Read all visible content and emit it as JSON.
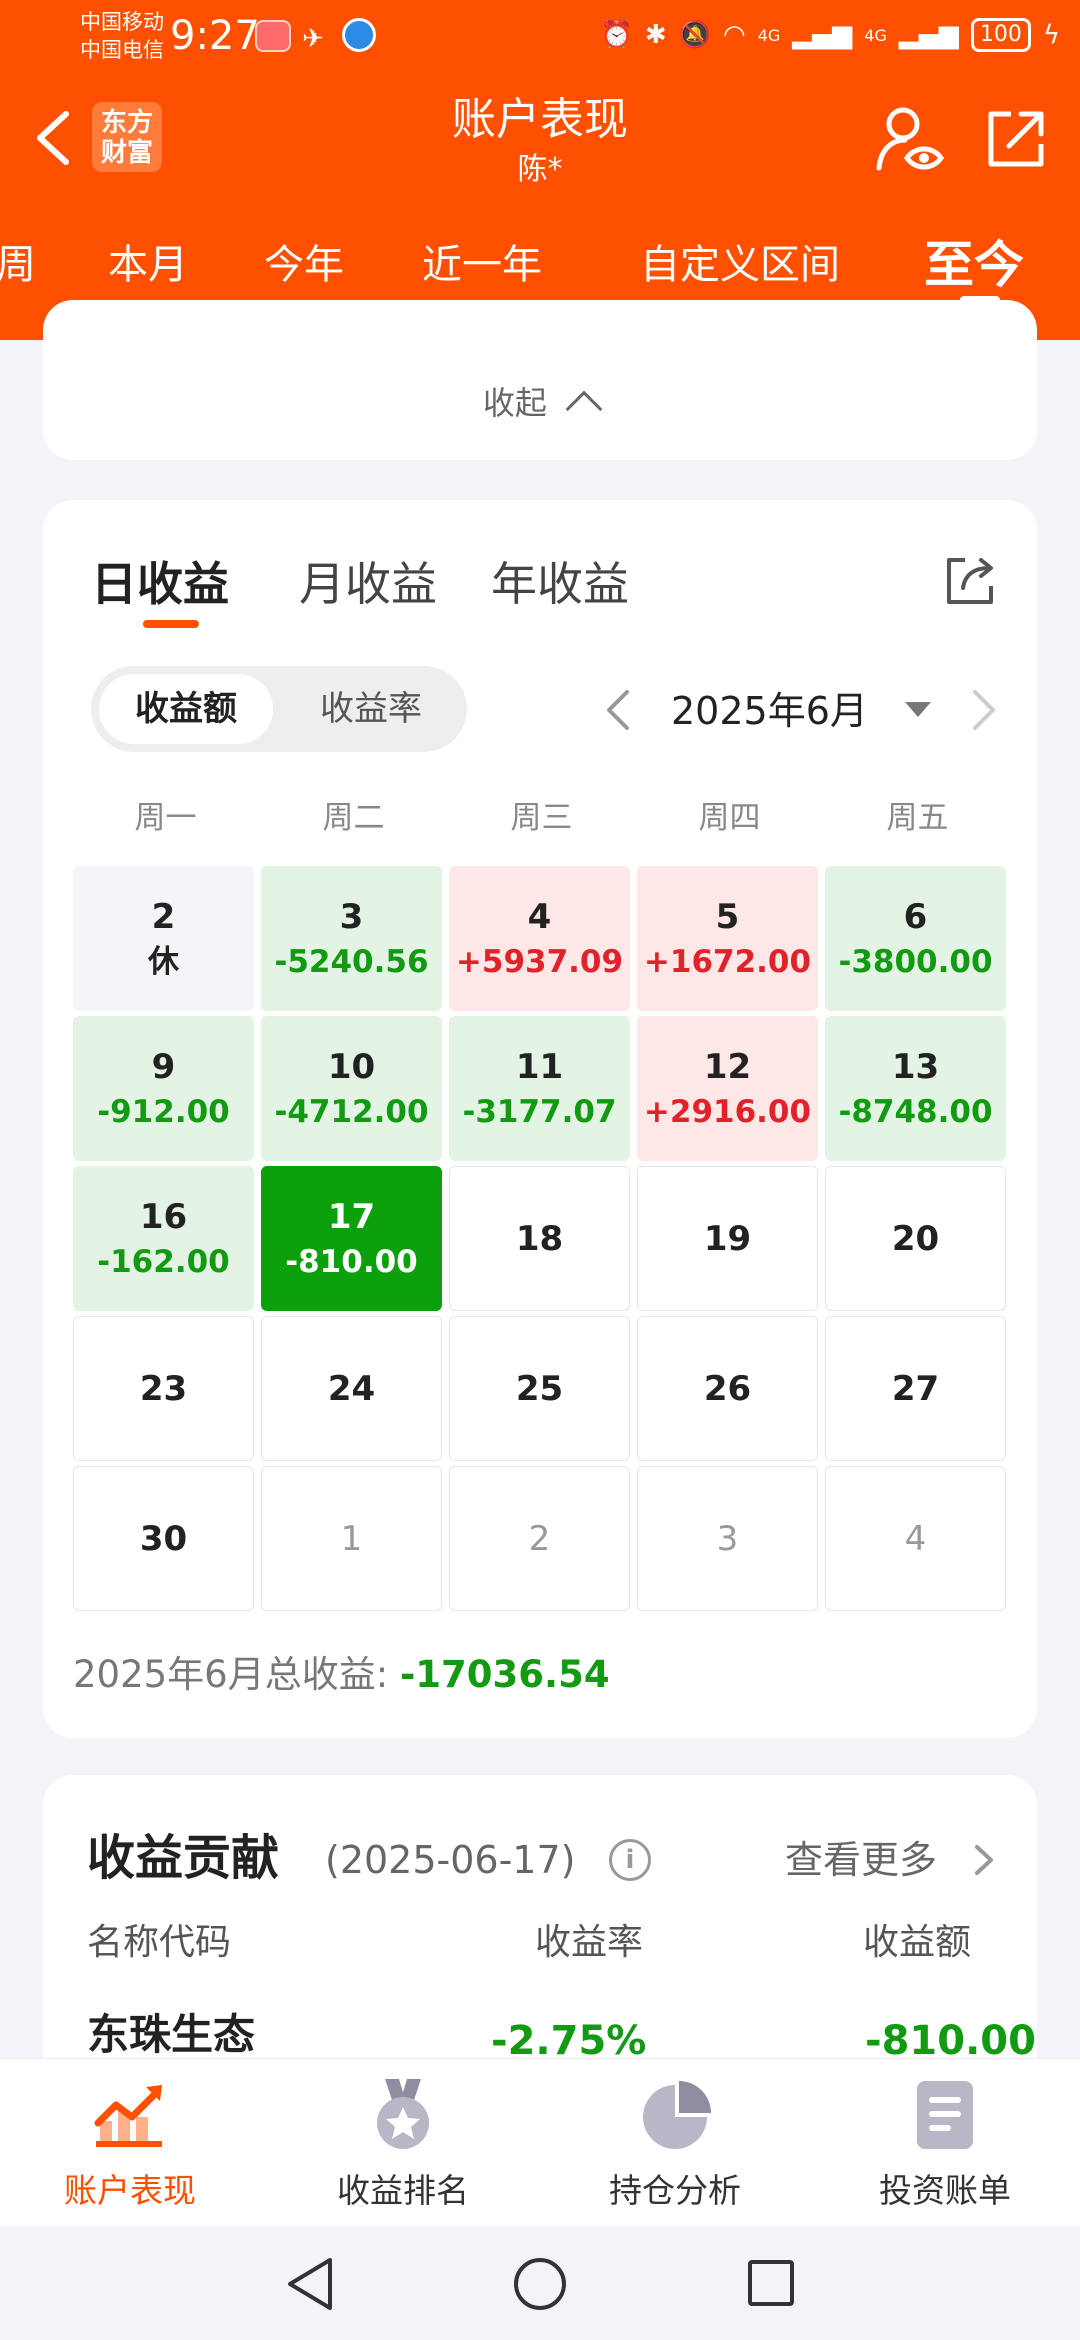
{
  "status_bar": {
    "carrier1": "中国移动",
    "carrier2": "中国电信",
    "time": "9:27",
    "signal1": "4G",
    "signal2": "4G",
    "battery": "100"
  },
  "header": {
    "logo_line1": "东方",
    "logo_line2": "财富",
    "title": "账户表现",
    "subtitle": "陈*",
    "periods": [
      "周",
      "本月",
      "今年",
      "近一年",
      "自定义区间",
      "至今"
    ],
    "active_period": "至今"
  },
  "collapse": {
    "label": "收起"
  },
  "calendar": {
    "tabs": [
      "日收益",
      "月收益",
      "年收益"
    ],
    "active_tab": "日收益",
    "segment": [
      "收益额",
      "收益率"
    ],
    "active_segment": "收益额",
    "month_label": "2025年6月",
    "weekdays": [
      "周一",
      "周二",
      "周三",
      "周四",
      "周五"
    ],
    "days": [
      {
        "day": "2",
        "value": "休",
        "state": "rest"
      },
      {
        "day": "3",
        "value": "-5240.56",
        "state": "loss"
      },
      {
        "day": "4",
        "value": "+5937.09",
        "state": "gain"
      },
      {
        "day": "5",
        "value": "+1672.00",
        "state": "gain"
      },
      {
        "day": "6",
        "value": "-3800.00",
        "state": "loss"
      },
      {
        "day": "9",
        "value": "-912.00",
        "state": "loss"
      },
      {
        "day": "10",
        "value": "-4712.00",
        "state": "loss"
      },
      {
        "day": "11",
        "value": "-3177.07",
        "state": "loss"
      },
      {
        "day": "12",
        "value": "+2916.00",
        "state": "gain"
      },
      {
        "day": "13",
        "value": "-8748.00",
        "state": "loss"
      },
      {
        "day": "16",
        "value": "-162.00",
        "state": "loss"
      },
      {
        "day": "17",
        "value": "-810.00",
        "state": "selected"
      },
      {
        "day": "18",
        "value": "",
        "state": "empty"
      },
      {
        "day": "19",
        "value": "",
        "state": "empty"
      },
      {
        "day": "20",
        "value": "",
        "state": "empty"
      },
      {
        "day": "23",
        "value": "",
        "state": "empty"
      },
      {
        "day": "24",
        "value": "",
        "state": "empty"
      },
      {
        "day": "25",
        "value": "",
        "state": "empty"
      },
      {
        "day": "26",
        "value": "",
        "state": "empty"
      },
      {
        "day": "27",
        "value": "",
        "state": "empty"
      },
      {
        "day": "30",
        "value": "",
        "state": "empty"
      },
      {
        "day": "1",
        "value": "",
        "state": "other"
      },
      {
        "day": "2",
        "value": "",
        "state": "other"
      },
      {
        "day": "3",
        "value": "",
        "state": "other"
      },
      {
        "day": "4",
        "value": "",
        "state": "other"
      }
    ],
    "total_label": "2025年6月总收益: ",
    "total_value": "-17036.54"
  },
  "contribution": {
    "title": "收益贡献",
    "date": "(2025-06-17)",
    "more": "查看更多",
    "columns": [
      "名称代码",
      "收益率",
      "收益额"
    ],
    "first_row": {
      "name": "东珠生态",
      "rate": "-2.75%",
      "amount": "-810.00"
    }
  },
  "tabbar": [
    {
      "label": "账户表现",
      "icon": "chart-up-icon",
      "active": true
    },
    {
      "label": "收益排名",
      "icon": "medal-icon",
      "active": false
    },
    {
      "label": "持仓分析",
      "icon": "pie-chart-icon",
      "active": false
    },
    {
      "label": "投资账单",
      "icon": "bill-icon",
      "active": false
    }
  ],
  "colors": {
    "brand": "#fe5000",
    "gain": "#e0222a",
    "loss": "#129a12",
    "gain_bg": "#fde7e7",
    "loss_bg": "#e4f4e4",
    "selected_bg": "#0ca10c"
  }
}
